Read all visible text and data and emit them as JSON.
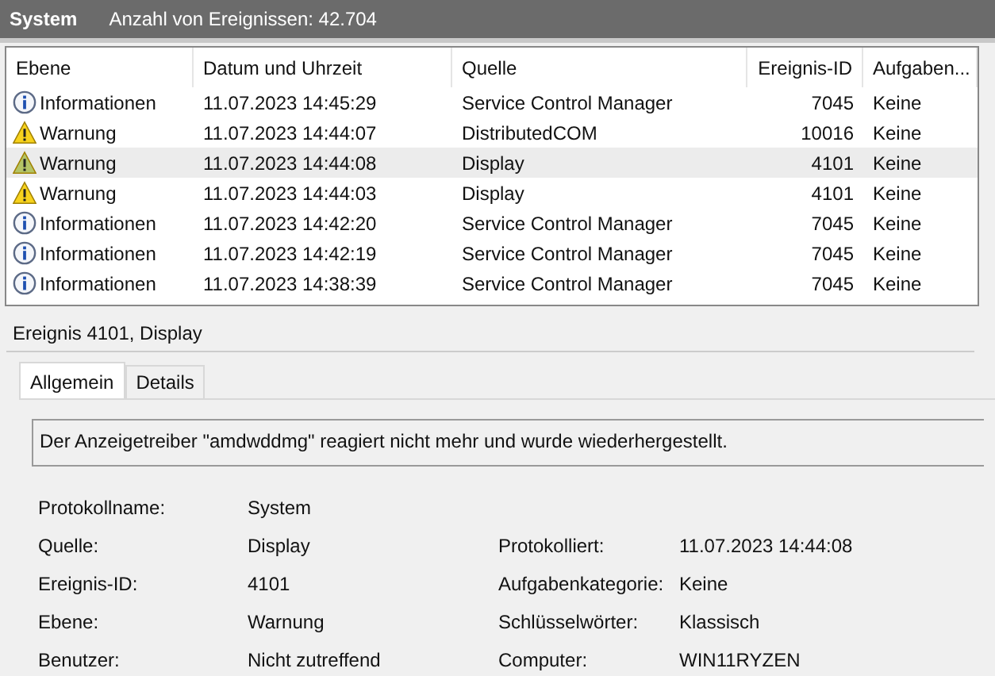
{
  "title_bar": {
    "log": "System",
    "count": "Anzahl von Ereignissen: 42.704"
  },
  "table": {
    "columns": [
      "Ebene",
      "Datum und Uhrzeit",
      "Quelle",
      "Ereignis-ID",
      "Aufgaben..."
    ],
    "rows": [
      {
        "kind": "info",
        "level": "Informationen",
        "date": "11.07.2023 14:45:29",
        "source": "Service Control Manager",
        "id": "7045",
        "task": "Keine",
        "selected": false
      },
      {
        "kind": "warning",
        "level": "Warnung",
        "date": "11.07.2023 14:44:07",
        "source": "DistributedCOM",
        "id": "10016",
        "task": "Keine",
        "selected": false
      },
      {
        "kind": "warning",
        "level": "Warnung",
        "date": "11.07.2023 14:44:08",
        "source": "Display",
        "id": "4101",
        "task": "Keine",
        "selected": true
      },
      {
        "kind": "warning",
        "level": "Warnung",
        "date": "11.07.2023 14:44:03",
        "source": "Display",
        "id": "4101",
        "task": "Keine",
        "selected": false
      },
      {
        "kind": "info",
        "level": "Informationen",
        "date": "11.07.2023 14:42:20",
        "source": "Service Control Manager",
        "id": "7045",
        "task": "Keine",
        "selected": false
      },
      {
        "kind": "info",
        "level": "Informationen",
        "date": "11.07.2023 14:42:19",
        "source": "Service Control Manager",
        "id": "7045",
        "task": "Keine",
        "selected": false
      },
      {
        "kind": "info",
        "level": "Informationen",
        "date": "11.07.2023 14:38:39",
        "source": "Service Control Manager",
        "id": "7045",
        "task": "Keine",
        "selected": false
      }
    ]
  },
  "detail": {
    "heading": "Ereignis 4101, Display",
    "tabs": [
      {
        "label": "Allgemein",
        "selected": true
      },
      {
        "label": "Details",
        "selected": false
      }
    ],
    "message": "Der Anzeigetreiber \"amdwddmg\" reagiert nicht mehr und wurde wiederhergestellt.",
    "fields": [
      [
        {
          "label": "Protokollname:",
          "value": "System"
        }
      ],
      [
        {
          "label": "Quelle:",
          "value": "Display"
        },
        {
          "label": "Protokolliert:",
          "value": "11.07.2023 14:44:08"
        }
      ],
      [
        {
          "label": "Ereignis-ID:",
          "value": "4101"
        },
        {
          "label": "Aufgabenkategorie:",
          "value": "Keine"
        }
      ],
      [
        {
          "label": "Ebene:",
          "value": "Warnung"
        },
        {
          "label": "Schlüsselwörter:",
          "value": "Klassisch"
        }
      ],
      [
        {
          "label": "Benutzer:",
          "value": "Nicht zutreffend"
        },
        {
          "label": "Computer:",
          "value": "WIN11RYZEN"
        }
      ]
    ]
  }
}
